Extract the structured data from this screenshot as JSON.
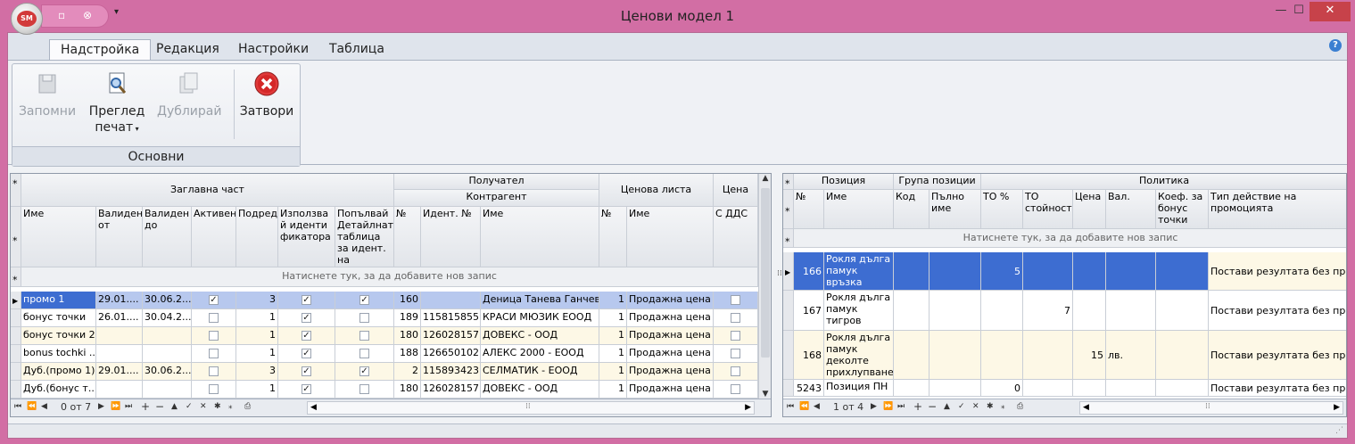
{
  "window": {
    "title": "Ценови модел 1",
    "orb_text": "SM",
    "minimize": "—",
    "maximize": "☐",
    "close": "✕"
  },
  "menu_tabs": [
    "Надстройка",
    "Редакция",
    "Настройки",
    "Таблица"
  ],
  "ribbon": {
    "group_label": "Основни",
    "buttons": {
      "save": "Запомни",
      "preview_l1": "Преглед",
      "preview_l2": "печат",
      "duplicate": "Дублирай",
      "close": "Затвори"
    }
  },
  "left_grid": {
    "band_headers": {
      "header_part": "Заглавна част",
      "recipient": "Получател",
      "counterparty": "Контрагент",
      "price_list": "Ценова листа",
      "price": "Цена"
    },
    "columns": [
      "Име",
      "Валиден от",
      "Валиден до",
      "Активен",
      "Подредба",
      "Използвай идентификатора",
      "Попълвай Детайлната таблица за идент. на надстр.",
      "№",
      "Идент. №",
      "Име",
      "№",
      "Име",
      "С ДДС"
    ],
    "new_row_text": "Натиснете тук, за да добавите нов запис",
    "rows": [
      {
        "name": "промо 1",
        "from": "29.01....",
        "to": "30.06.2...",
        "active": true,
        "order": "3",
        "use_id": true,
        "fill": true,
        "rec_no": "160",
        "ident": "",
        "rec_name": "Деница Танева Ганчева",
        "pl_no": "1",
        "pl_name": "Продажна цена",
        "vat": false
      },
      {
        "name": "бонус точки",
        "from": "26.01....",
        "to": "30.04.2...",
        "active": false,
        "order": "1",
        "use_id": true,
        "fill": false,
        "rec_no": "189",
        "ident": "115815855",
        "rec_name": "КРАСИ МЮЗИК ЕООД",
        "pl_no": "1",
        "pl_name": "Продажна цена",
        "vat": false
      },
      {
        "name": "бонус точки 2",
        "from": "",
        "to": "",
        "active": false,
        "order": "1",
        "use_id": true,
        "fill": false,
        "rec_no": "180",
        "ident": "126028157",
        "rec_name": "ДОВЕКС - ООД",
        "pl_no": "1",
        "pl_name": "Продажна цена",
        "vat": false
      },
      {
        "name": "bonus tochki ...",
        "from": "",
        "to": "",
        "active": false,
        "order": "1",
        "use_id": true,
        "fill": false,
        "rec_no": "188",
        "ident": "126650102",
        "rec_name": "АЛЕКС 2000 - ЕООД",
        "pl_no": "1",
        "pl_name": "Продажна цена",
        "vat": false
      },
      {
        "name": "Дуб.(промо 1)",
        "from": "29.01....",
        "to": "30.06.2...",
        "active": false,
        "order": "3",
        "use_id": true,
        "fill": true,
        "rec_no": "2",
        "ident": "115893423",
        "rec_name": "СЕЛМАТИК - ЕООД",
        "pl_no": "1",
        "pl_name": "Продажна цена",
        "vat": false
      },
      {
        "name": "Дуб.(бонус т...",
        "from": "",
        "to": "",
        "active": false,
        "order": "1",
        "use_id": true,
        "fill": false,
        "rec_no": "180",
        "ident": "126028157",
        "rec_name": "ДОВЕКС - ООД",
        "pl_no": "1",
        "pl_name": "Продажна цена",
        "vat": false
      }
    ],
    "record_counter": "0 от 7"
  },
  "right_grid": {
    "band_headers": {
      "position": "Позиция",
      "group": "Група позиции",
      "policy": "Политика"
    },
    "columns": [
      "№",
      "Име",
      "Код",
      "Пълно име",
      "ТО %",
      "ТО стойност",
      "Цена",
      "Вал.",
      "Коеф. за бонус точки",
      "Тип действие на промоцията"
    ],
    "new_row_text": "Натиснете тук, за да добавите нов запис",
    "rows": [
      {
        "no": "166",
        "name": "Рокля дълга памук връзка звънчета",
        "code": "",
        "full": "",
        "to_pct": "5",
        "to_val": "",
        "price": "",
        "cur": "",
        "coef": "",
        "action": "Постави резултата без про..."
      },
      {
        "no": "167",
        "name": "Рокля дълга памук тигров принт",
        "code": "",
        "full": "",
        "to_pct": "",
        "to_val": "7",
        "price": "",
        "cur": "",
        "coef": "",
        "action": "Постави резултата без про..."
      },
      {
        "no": "168",
        "name": "Рокля дълга памук деколте прихлупване",
        "code": "",
        "full": "",
        "to_pct": "",
        "to_val": "",
        "price": "15",
        "cur": "лв.",
        "coef": "",
        "action": "Постави резултата без про..."
      },
      {
        "no": "5243",
        "name": "Позиция ПН",
        "code": "",
        "full": "",
        "to_pct": "0",
        "to_val": "",
        "price": "",
        "cur": "",
        "coef": "",
        "action": "Постави резултата без про..."
      }
    ],
    "record_counter": "1 от 4"
  }
}
